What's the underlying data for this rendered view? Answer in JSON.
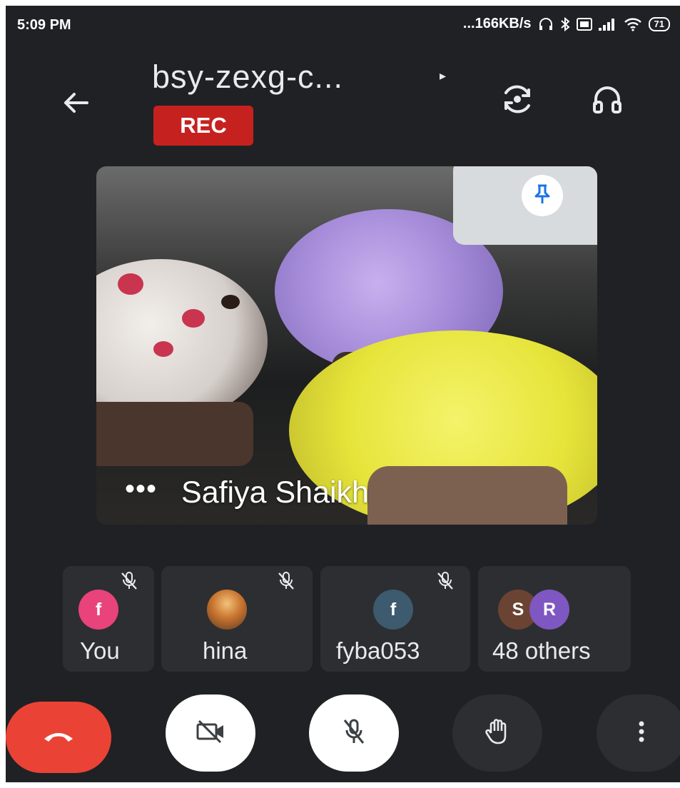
{
  "status_bar": {
    "time": "5:09 PM",
    "network_speed": "...166KB/s",
    "battery": "71",
    "icons": [
      "headset-icon",
      "bluetooth-icon",
      "volte-icon",
      "signal-icon",
      "wifi-icon",
      "battery-icon"
    ]
  },
  "header": {
    "meeting_code": "bsy-zexg-c...",
    "caret": "▸",
    "recording_label": "REC",
    "back_icon": "back-arrow-icon",
    "switch_camera_icon": "switch-camera-icon",
    "audio_output_icon": "headphones-icon"
  },
  "main_tile": {
    "participant_name": "Safiya Shaikh",
    "more_label": "•••",
    "pin_icon": "pin-icon"
  },
  "participants": [
    {
      "name": "You",
      "avatar_letter": "f",
      "avatar_color": "#e8437a",
      "muted": true
    },
    {
      "name": "hina",
      "avatar_letter": "",
      "avatar_color": "#8a5a2b",
      "muted": true
    },
    {
      "name": "fyba053",
      "avatar_letter": "f",
      "avatar_color": "#3d5a6e",
      "muted": true
    },
    {
      "name": "48 others",
      "avatar_letter": "S",
      "avatar_letter_2": "R",
      "avatar_color": "#6b4332",
      "avatar_color_2": "#7e57c2",
      "muted": false
    }
  ],
  "controls": {
    "end_call_icon": "end-call-icon",
    "camera_icon": "camera-off-icon",
    "mic_icon": "mic-off-icon",
    "hand_icon": "raise-hand-icon",
    "more_icon": "more-vert-icon",
    "colors": {
      "end_call": "#ea4335",
      "active": "#ffffff",
      "inactive": "#2d2e31"
    }
  }
}
